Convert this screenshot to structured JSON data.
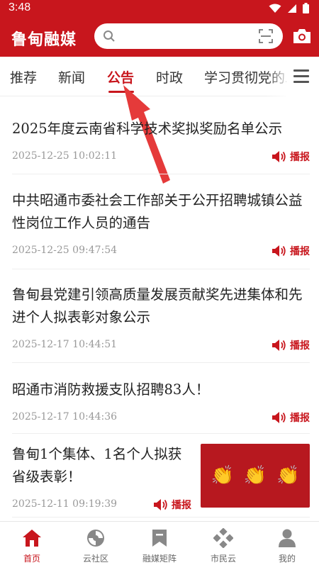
{
  "status_bar": {
    "time": "3:48"
  },
  "app": {
    "logo": "鲁甸融媒",
    "search_placeholder": ""
  },
  "tabs": [
    {
      "label": "推荐"
    },
    {
      "label": "新闻"
    },
    {
      "label": "公告"
    },
    {
      "label": "时政"
    },
    {
      "label": "学习贯彻党的二"
    }
  ],
  "active_tab": "公告",
  "news": [
    {
      "title": "2025年度云南省科学技术奖拟奖励名单公示",
      "date": "2025-12-25 10:02:11",
      "broadcast": "播报"
    },
    {
      "title": "中共昭通市委社会工作部关于公开招聘城镇公益性岗位工作人员的通告",
      "date": "2025-12-25 09:47:54",
      "broadcast": "播报"
    },
    {
      "title": "鲁甸县党建引领高质量发展贡献奖先进集体和先进个人拟表彰对象公示",
      "date": "2025-12-17 10:44:51",
      "broadcast": "播报"
    },
    {
      "title": "昭通市消防救援支队招聘83人！",
      "date": "2025-12-17 10:44:36",
      "broadcast": "播报"
    },
    {
      "title": "鲁甸1个集体、1名个人拟获省级表彰！",
      "date": "2025-12-11 09:19:39",
      "broadcast": "播报",
      "thumbnail": "clapping-hands"
    }
  ],
  "bottom_nav": [
    {
      "label": "首页",
      "icon": "home-icon"
    },
    {
      "label": "云社区",
      "icon": "community-icon"
    },
    {
      "label": "融媒矩阵",
      "icon": "bookmark-icon"
    },
    {
      "label": "市民云",
      "icon": "diamond-grid-icon"
    },
    {
      "label": "我的",
      "icon": "user-icon"
    }
  ],
  "colors": {
    "brand": "#c8161d",
    "text": "#222222",
    "muted": "#999999"
  }
}
